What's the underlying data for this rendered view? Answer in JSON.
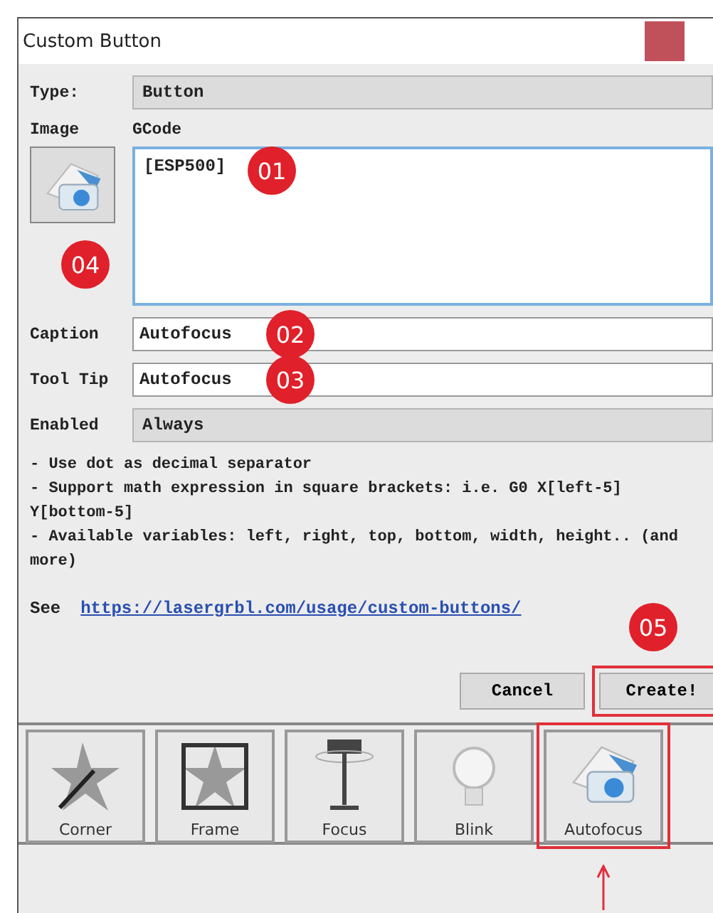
{
  "window": {
    "title": "Custom Button"
  },
  "form": {
    "type_label": "Type:",
    "type_value": "Button",
    "image_label": "Image",
    "gcode_label": "GCode",
    "gcode_value": "[ESP500]",
    "caption_label": "Caption",
    "caption_value": "Autofocus",
    "tooltip_label": "Tool Tip",
    "tooltip_value": "Autofocus",
    "enabled_label": "Enabled",
    "enabled_value": "Always"
  },
  "notes": [
    "- Use dot as decimal separator",
    "- Support math expression in square brackets: i.e. G0 X[left-5] Y[bottom-5]",
    "- Available variables: left, right, top, bottom, width, height.. (and more)"
  ],
  "link": {
    "prefix": "See",
    "url": "https://lasergrbl.com/usage/custom-buttons/"
  },
  "buttons": [
    {
      "label": "Cancel",
      "highlighted": false
    },
    {
      "label": "Create!",
      "highlighted": true
    }
  ],
  "toolbar": [
    {
      "label": "Corner",
      "kind": "corner",
      "highlighted": false
    },
    {
      "label": "Frame",
      "kind": "frame",
      "highlighted": false
    },
    {
      "label": "Focus",
      "kind": "focus",
      "highlighted": false
    },
    {
      "label": "Blink",
      "kind": "blink",
      "highlighted": false
    },
    {
      "label": "Autofocus",
      "kind": "autofocus",
      "highlighted": true
    }
  ],
  "callouts": {
    "gcode": "01",
    "caption": "02",
    "tooltip": "03",
    "image": "04",
    "create": "05"
  }
}
